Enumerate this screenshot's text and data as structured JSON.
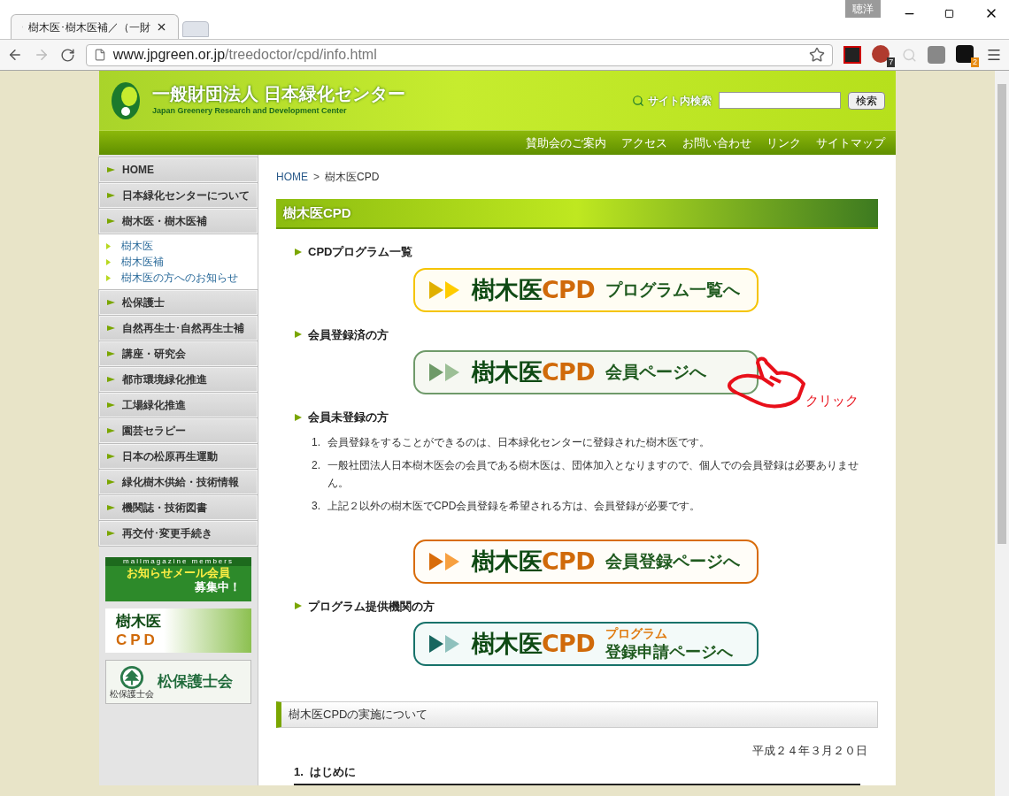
{
  "browser": {
    "tab_title": "樹木医･樹木医補／（一財",
    "profile": "聴洋",
    "url_host": "www.jpgreen.or.jp",
    "url_path": "/treedoctor/cpd/info.html",
    "extension_badges": [
      "7",
      "2"
    ]
  },
  "header": {
    "org_name": "一般財団法人 日本緑化センター",
    "org_name_en": "Japan Greenery Research and Development Center",
    "search_label": "サイト内検索",
    "search_button": "検索"
  },
  "nav": [
    "賛助会のご案内",
    "アクセス",
    "お問い合わせ",
    "リンク",
    "サイトマップ"
  ],
  "sidebar": {
    "items": [
      {
        "label": "HOME"
      },
      {
        "label": "日本緑化センターについて"
      },
      {
        "label": "樹木医・樹木医補",
        "children": [
          {
            "label": "樹木医"
          },
          {
            "label": "樹木医補"
          },
          {
            "label": "樹木医の方へのお知らせ"
          }
        ]
      },
      {
        "label": "松保護士"
      },
      {
        "label": "自然再生士･自然再生士補"
      },
      {
        "label": "講座・研究会"
      },
      {
        "label": "都市環境緑化推進"
      },
      {
        "label": "工場緑化推進"
      },
      {
        "label": "園芸セラピー"
      },
      {
        "label": "日本の松原再生運動"
      },
      {
        "label": "緑化樹木供給・技術情報"
      },
      {
        "label": "機関誌・技術図書"
      },
      {
        "label": "再交付･変更手続き"
      }
    ],
    "mail_banner": {
      "top": "mailmagazine members",
      "line1": "お知らせメール会員",
      "line2": "募集中！"
    },
    "cpd_banner": {
      "title": "樹木医",
      "accent": "CPD"
    },
    "society_banner": {
      "title": "松保護士会",
      "small": "松保護士会"
    }
  },
  "breadcrumb_separator": ">",
  "breadcrumb": [
    {
      "label": "HOME",
      "link": true
    },
    {
      "label": "樹木医CPD",
      "link": false
    }
  ],
  "page_title": "樹木医CPD",
  "sections": [
    {
      "heading": "CPDプログラム一覧",
      "banner": {
        "kind": "yellow",
        "title": "樹木医",
        "accent": "CPD",
        "sub": [
          "プログラム一覧へ"
        ]
      }
    },
    {
      "heading": "会員登録済の方",
      "banner": {
        "kind": "green",
        "title": "樹木医",
        "accent": "CPD",
        "sub": [
          "会員ページへ"
        ]
      },
      "annotation": "クリック"
    },
    {
      "heading": "会員未登録の方",
      "items": [
        {
          "number": "1.",
          "text": "会員登録をすることができるのは、日本緑化センターに登録された樹木医です。"
        },
        {
          "number": "2.",
          "text": "一般社団法人日本樹木医会の会員である樹木医は、団体加入となりますので、個人での会員登録は必要ありません。"
        },
        {
          "number": "3.",
          "text": "上記２以外の樹木医でCPD会員登録を希望される方は、会員登録が必要です。"
        }
      ],
      "banner": {
        "kind": "orange",
        "title": "樹木医",
        "accent": "CPD",
        "sub": [
          "会員登録ページへ"
        ]
      }
    },
    {
      "heading": "プログラム提供機関の方",
      "banner": {
        "kind": "teal",
        "title": "樹木医",
        "accent": "CPD",
        "sub": [
          "プログラム",
          "登録申請ページへ"
        ]
      }
    }
  ],
  "notice": {
    "heading": "樹木医CPDの実施について",
    "date": "平成２４年３月２０日",
    "subheading": "1.  はじめに"
  }
}
